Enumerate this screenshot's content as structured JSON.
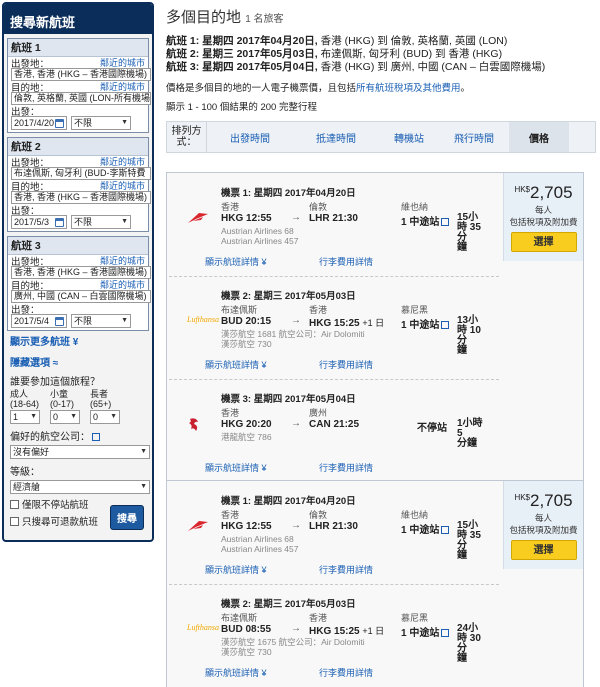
{
  "sidebar": {
    "title": "搜尋新航班",
    "legs": [
      {
        "head": "航班 1",
        "from_label": "出發地：",
        "nearby": "鄰近的城市",
        "from_value": "香港, 香港 (HKG – 香港國際機場)",
        "to_label": "目的地：",
        "nearby2": "鄰近的城市",
        "to_value": "倫敦, 英格蘭, 英國 (LON-所有機場",
        "date_label": "出發：",
        "date_value": "2017/4/20",
        "time_value": "不限"
      },
      {
        "head": "航班 2",
        "from_label": "出發地：",
        "nearby": "鄰近的城市",
        "from_value": "布達佩斯, 匈牙利 (BUD-李斯特費",
        "to_label": "目的地：",
        "nearby2": "鄰近的城市",
        "to_value": "香港, 香港 (HKG – 香港國際機場)",
        "date_label": "出發：",
        "date_value": "2017/5/3",
        "time_value": "不限"
      },
      {
        "head": "航班 3",
        "from_label": "出發地：",
        "nearby": "鄰近的城市",
        "from_value": "香港, 香港 (HKG – 香港國際機場)",
        "to_label": "目的地：",
        "nearby2": "鄰近的城市",
        "to_value": "廣州, 中國 (CAN – 白雲國際機場)",
        "date_label": "出發：",
        "date_value": "2017/5/4",
        "time_value": "不限"
      }
    ],
    "more_flights": "顯示更多航班 ¥",
    "hide_options": "隱藏選項 ≈",
    "who_label": "誰要參加這個旅程？",
    "adult": {
      "label": "成人",
      "range": "(18-64)",
      "value": "1"
    },
    "child": {
      "label": "小童",
      "range": "(0-17)",
      "value": "0"
    },
    "senior": {
      "label": "長者",
      "range": "(65+)",
      "value": "0"
    },
    "airline_label": "偏好的航空公司：",
    "airline_value": "沒有偏好",
    "class_label": "等級：",
    "class_value": "經濟艙",
    "nonstop_label": "僅限不停站航班",
    "refundable_label": "只搜尋可退款航班",
    "search_button": "搜尋"
  },
  "header": {
    "title": "多個目的地",
    "travelers": "1 名旅客",
    "itin": [
      {
        "label": "航班 1: 星期四 2017年04月20日,",
        "route": " 香港 (HKG) 到 倫敦, 英格蘭, 英國 (LON)"
      },
      {
        "label": "航班 2: 星期三 2017年05月03日,",
        "route": " 布達佩斯, 匈牙利 (BUD) 到 香港 (HKG)"
      },
      {
        "label": "航班 3: 星期四 2017年05月04日,",
        "route": " 香港 (HKG) 到 廣州, 中國 (CAN – 白雲國際機場)"
      }
    ],
    "info_pre": "價格是多個目的地的一人電子機票價，且包括",
    "info_link": "所有航班稅項及其他費用",
    "info_post": "。",
    "showing": "顯示 1 - 100 個結果的 200 完整行程"
  },
  "sort": {
    "label": "排列方式：",
    "options": [
      "出發時間",
      "抵達時間",
      "轉機站",
      "飛行時間",
      "價格"
    ]
  },
  "results": [
    {
      "price_currency": "HK$",
      "price_value": "2,705",
      "price_sub1": "每人",
      "price_sub2": "包括稅項及附加費",
      "select_label": "選擇",
      "segments": [
        {
          "title": "機票 1: 星期四 2017年04月20日",
          "dep_city": "香港",
          "arr_city": "倫敦",
          "via_city": "維也納",
          "dep_code": "HKG",
          "dep_time": "12:55",
          "arr_code": "LHR",
          "arr_time": "21:30",
          "arr_plus": "",
          "stops": "1 中途站",
          "dur1": "15小",
          "dur2": "時 35分",
          "dur3": "鐘",
          "airline1": "Austrian Airlines 68",
          "airline2": "Austrian Airlines 457",
          "details": "顯示航班詳情 ¥",
          "rules": "行李費用詳情",
          "logo": "austrian"
        },
        {
          "title": "機票 2: 星期三 2017年05月03日",
          "dep_city": "布達佩斯",
          "arr_city": "香港",
          "via_city": "慕尼黑",
          "dep_code": "BUD",
          "dep_time": "20:15",
          "arr_code": "HKG",
          "arr_time": "15:25",
          "arr_plus": "+1 日",
          "stops": "1 中途站",
          "dur1": "13小",
          "dur2": "時 10分",
          "dur3": "鐘",
          "airline1": "漢莎航空 1681 航空公司：Air Dolomiti",
          "airline2": "漢莎航空 730",
          "details": "顯示航班詳情 ¥",
          "rules": "行李費用詳情",
          "logo": "lufthansa"
        },
        {
          "title": "機票 3: 星期四 2017年05月04日",
          "dep_city": "香港",
          "arr_city": "廣州",
          "via_city": "",
          "dep_code": "HKG",
          "dep_time": "20:20",
          "arr_code": "CAN",
          "arr_time": "21:25",
          "arr_plus": "",
          "stops": "不停站",
          "dur1": "1小時 5",
          "dur2": "分鐘",
          "dur3": "",
          "airline1": "港龍航空 786",
          "airline2": "",
          "details": "顯示航班詳情 ¥",
          "rules": "行李費用詳情",
          "logo": "dragonair"
        }
      ]
    },
    {
      "price_currency": "HK$",
      "price_value": "2,705",
      "price_sub1": "每人",
      "price_sub2": "包括稅項及附加費",
      "select_label": "選擇",
      "segments": [
        {
          "title": "機票 1: 星期四 2017年04月20日",
          "dep_city": "香港",
          "arr_city": "倫敦",
          "via_city": "維也納",
          "dep_code": "HKG",
          "dep_time": "12:55",
          "arr_code": "LHR",
          "arr_time": "21:30",
          "arr_plus": "",
          "stops": "1 中途站",
          "dur1": "15小",
          "dur2": "時 35分",
          "dur3": "鐘",
          "airline1": "Austrian Airlines 68",
          "airline2": "Austrian Airlines 457",
          "details": "顯示航班詳情 ¥",
          "rules": "行李費用詳情",
          "logo": "austrian"
        },
        {
          "title": "機票 2: 星期三 2017年05月03日",
          "dep_city": "布達佩斯",
          "arr_city": "香港",
          "via_city": "慕尼黑",
          "dep_code": "BUD",
          "dep_time": "08:55",
          "arr_code": "HKG",
          "arr_time": "15:25",
          "arr_plus": "+1 日",
          "stops": "1 中途站",
          "dur1": "24小",
          "dur2": "時 30分",
          "dur3": "鐘",
          "airline1": "漢莎航空 1675 航空公司：Air Dolomiti",
          "airline2": "漢莎航空 730",
          "details": "顯示航班詳情 ¥",
          "rules": "行李費用詳情",
          "logo": "lufthansa"
        }
      ]
    }
  ],
  "colors": {
    "navy": "#0b2d59",
    "link": "#1a5fb4",
    "select_yellow": "#f8cd1f"
  }
}
